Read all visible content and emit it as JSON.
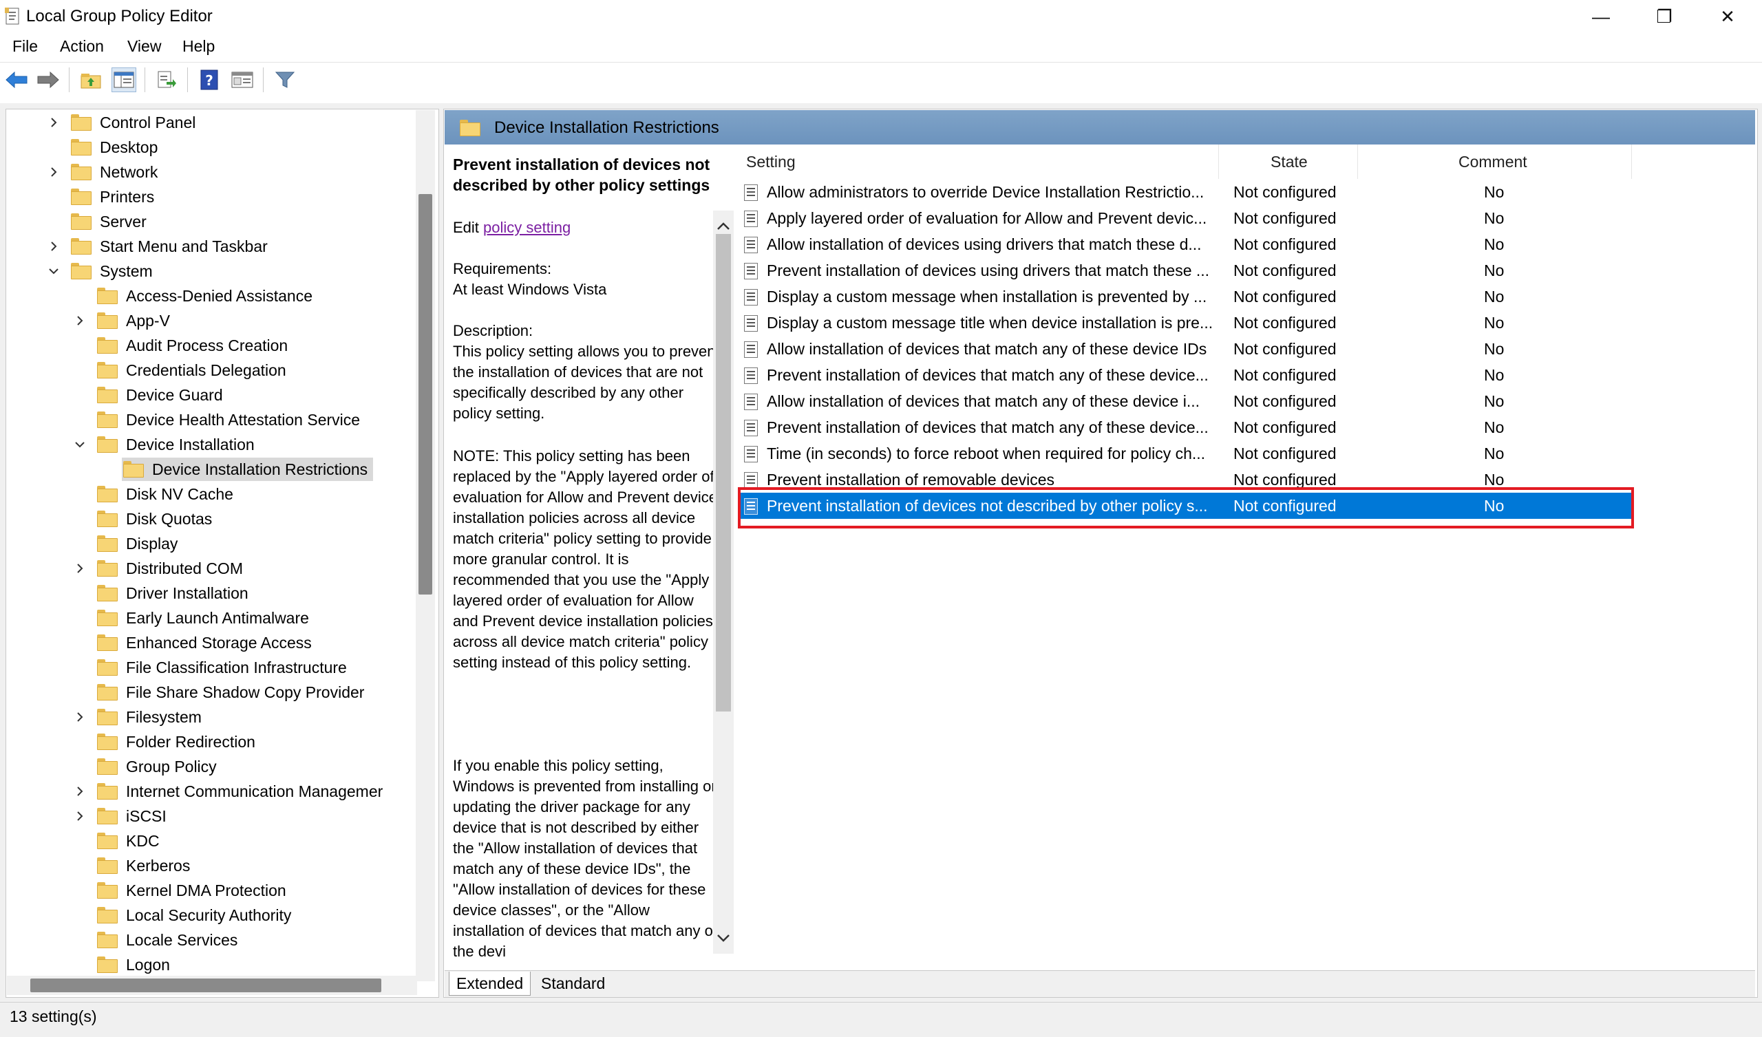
{
  "window": {
    "title": "Local Group Policy Editor",
    "minimize_glyph": "—",
    "restore_glyph": "❐",
    "close_glyph": "✕"
  },
  "menu": {
    "items": [
      "File",
      "Action",
      "View",
      "Help"
    ]
  },
  "toolbar": {
    "icons": [
      "back-arrow-icon",
      "forward-arrow-icon",
      "up-folder-icon",
      "show-hide-tree-icon",
      "export-list-icon",
      "help-icon",
      "properties-icon",
      "filter-icon"
    ]
  },
  "tree": {
    "items": [
      {
        "label": "Control Panel",
        "expandable": true,
        "expanded": false,
        "level": 0
      },
      {
        "label": "Desktop",
        "expandable": false,
        "level": 0
      },
      {
        "label": "Network",
        "expandable": true,
        "expanded": false,
        "level": 0
      },
      {
        "label": "Printers",
        "expandable": false,
        "level": 0
      },
      {
        "label": "Server",
        "expandable": false,
        "level": 0
      },
      {
        "label": "Start Menu and Taskbar",
        "expandable": true,
        "expanded": false,
        "level": 0
      },
      {
        "label": "System",
        "expandable": true,
        "expanded": true,
        "level": 0
      },
      {
        "label": "Access-Denied Assistance",
        "expandable": false,
        "level": 1
      },
      {
        "label": "App-V",
        "expandable": true,
        "expanded": false,
        "level": 1
      },
      {
        "label": "Audit Process Creation",
        "expandable": false,
        "level": 1
      },
      {
        "label": "Credentials Delegation",
        "expandable": false,
        "level": 1
      },
      {
        "label": "Device Guard",
        "expandable": false,
        "level": 1
      },
      {
        "label": "Device Health Attestation Service",
        "expandable": false,
        "level": 1
      },
      {
        "label": "Device Installation",
        "expandable": true,
        "expanded": true,
        "level": 1
      },
      {
        "label": "Device Installation Restrictions",
        "expandable": false,
        "level": 2,
        "selected": true
      },
      {
        "label": "Disk NV Cache",
        "expandable": false,
        "level": 1
      },
      {
        "label": "Disk Quotas",
        "expandable": false,
        "level": 1
      },
      {
        "label": "Display",
        "expandable": false,
        "level": 1
      },
      {
        "label": "Distributed COM",
        "expandable": true,
        "expanded": false,
        "level": 1
      },
      {
        "label": "Driver Installation",
        "expandable": false,
        "level": 1
      },
      {
        "label": "Early Launch Antimalware",
        "expandable": false,
        "level": 1
      },
      {
        "label": "Enhanced Storage Access",
        "expandable": false,
        "level": 1
      },
      {
        "label": "File Classification Infrastructure",
        "expandable": false,
        "level": 1
      },
      {
        "label": "File Share Shadow Copy Provider",
        "expandable": false,
        "level": 1
      },
      {
        "label": "Filesystem",
        "expandable": true,
        "expanded": false,
        "level": 1
      },
      {
        "label": "Folder Redirection",
        "expandable": false,
        "level": 1
      },
      {
        "label": "Group Policy",
        "expandable": false,
        "level": 1
      },
      {
        "label": "Internet Communication Managemer",
        "expandable": true,
        "expanded": false,
        "level": 1
      },
      {
        "label": "iSCSI",
        "expandable": true,
        "expanded": false,
        "level": 1
      },
      {
        "label": "KDC",
        "expandable": false,
        "level": 1
      },
      {
        "label": "Kerberos",
        "expandable": false,
        "level": 1
      },
      {
        "label": "Kernel DMA Protection",
        "expandable": false,
        "level": 1
      },
      {
        "label": "Local Security Authority",
        "expandable": false,
        "level": 1
      },
      {
        "label": "Locale Services",
        "expandable": false,
        "level": 1
      },
      {
        "label": "Logon",
        "expandable": false,
        "level": 1
      }
    ]
  },
  "right": {
    "header_title": "Device Installation Restrictions",
    "description": {
      "heading": "Prevent installation of devices not described by other policy settings",
      "edit_prefix": "Edit ",
      "edit_link": "policy setting ",
      "requirements_label": "Requirements:",
      "requirements_value": "At least Windows Vista",
      "description_label": "Description:",
      "para1": "This policy setting allows you to prevent the installation of devices that are not specifically described by any other policy setting.",
      "para2": "NOTE: This policy setting has been replaced by the \"Apply layered order of evaluation for Allow and Prevent device installation policies across all device match criteria\" policy setting to provide more granular control. It is recommended that you use the \"Apply layered order of evaluation for Allow and Prevent device installation policies across all device match criteria\" policy setting instead of this policy setting.",
      "para3": "If you enable this policy setting, Windows is prevented from installing or updating the driver package for any device that is not described by either the \"Allow installation of devices that match any of these device IDs\", the \"Allow installation of devices for these device classes\", or the \"Allow installation of devices that match any of the devi"
    },
    "columns": {
      "setting": "Setting",
      "state": "State",
      "comment": "Comment"
    },
    "rows": [
      {
        "setting": "Allow administrators to override Device Installation Restrictio...",
        "state": "Not configured",
        "comment": "No"
      },
      {
        "setting": "Apply layered order of evaluation for Allow and Prevent devic...",
        "state": "Not configured",
        "comment": "No"
      },
      {
        "setting": "Allow installation of devices using drivers that match these d...",
        "state": "Not configured",
        "comment": "No"
      },
      {
        "setting": "Prevent installation of devices using drivers that match these ...",
        "state": "Not configured",
        "comment": "No"
      },
      {
        "setting": "Display a custom message when installation is prevented by ...",
        "state": "Not configured",
        "comment": "No"
      },
      {
        "setting": "Display a custom message title when device installation is pre...",
        "state": "Not configured",
        "comment": "No"
      },
      {
        "setting": "Allow installation of devices that match any of these device IDs",
        "state": "Not configured",
        "comment": "No"
      },
      {
        "setting": "Prevent installation of devices that match any of these device...",
        "state": "Not configured",
        "comment": "No"
      },
      {
        "setting": "Allow installation of devices that match any of these device i...",
        "state": "Not configured",
        "comment": "No"
      },
      {
        "setting": "Prevent installation of devices that match any of these device...",
        "state": "Not configured",
        "comment": "No"
      },
      {
        "setting": "Time (in seconds) to force reboot when required for policy ch...",
        "state": "Not configured",
        "comment": "No"
      },
      {
        "setting": "Prevent installation of removable devices",
        "state": "Not configured",
        "comment": "No"
      },
      {
        "setting": "Prevent installation of devices not described by other policy s...",
        "state": "Not configured",
        "comment": "No",
        "selected": true
      }
    ],
    "tabs": [
      "Extended",
      "Standard"
    ]
  },
  "status": {
    "text": "13 setting(s)"
  },
  "colors": {
    "selection": "#0078d7",
    "highlight_box": "#e31b23",
    "header_band": "#7fa3c8",
    "link": "#7b1fa2"
  }
}
